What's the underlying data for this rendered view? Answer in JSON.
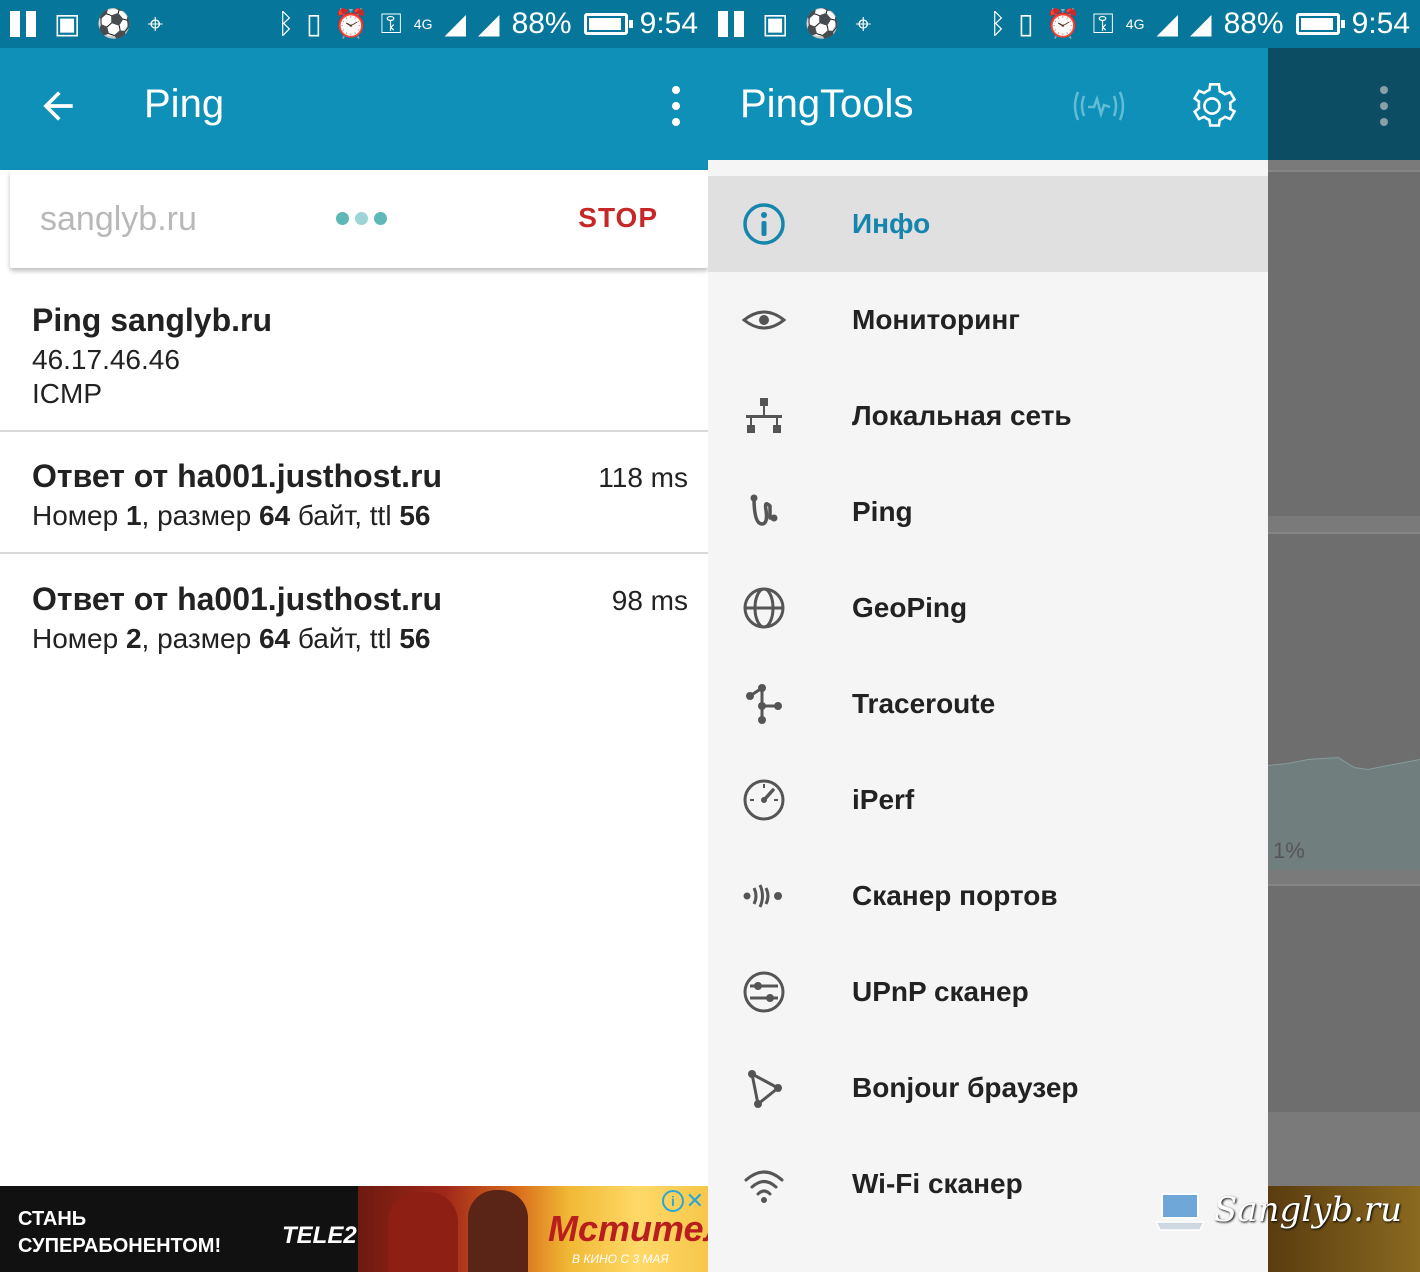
{
  "status_bar": {
    "battery": "88%",
    "time": "9:54",
    "network": "4G"
  },
  "left": {
    "appbar": {
      "title": "Ping"
    },
    "search": {
      "value": "sanglyb.ru",
      "stop_label": "STOP"
    },
    "header_result": {
      "title": "Ping sanglyb.ru",
      "ip": "46.17.46.46",
      "protocol": "ICMP"
    },
    "replies": [
      {
        "title": "Ответ от ha001.justhost.ru",
        "ms": "118 ms",
        "num_label": "Номер",
        "num": "1",
        "size_label": ", размер",
        "size": "64",
        "ttl_label": "байт, ttl",
        "ttl": "56"
      },
      {
        "title": "Ответ от ha001.justhost.ru",
        "ms": "98 ms",
        "num_label": "Номер",
        "num": "2",
        "size_label": ", размер",
        "size": "64",
        "ttl_label": "байт, ttl",
        "ttl": "56"
      }
    ],
    "ad": {
      "text_line1": "СТАНЬ",
      "text_line2": "СУПЕРАБОНЕНТОМ!",
      "brand": "TELE2",
      "movie_title": "Мстители",
      "movie_sub": "В КИНО С 3 МАЯ"
    }
  },
  "right": {
    "drawer": {
      "title": "PingTools",
      "items": [
        {
          "label": "Инфо",
          "icon": "info-icon"
        },
        {
          "label": "Мониторинг",
          "icon": "eye-icon"
        },
        {
          "label": "Локальная сеть",
          "icon": "lan-icon"
        },
        {
          "label": "Ping",
          "icon": "ping-icon"
        },
        {
          "label": "GeoPing",
          "icon": "globe-icon"
        },
        {
          "label": "Traceroute",
          "icon": "traceroute-icon"
        },
        {
          "label": "iPerf",
          "icon": "speedometer-icon"
        },
        {
          "label": "Сканер портов",
          "icon": "port-scanner-icon"
        },
        {
          "label": "UPnP сканер",
          "icon": "upnp-icon"
        },
        {
          "label": "Bonjour браузер",
          "icon": "bonjour-icon"
        },
        {
          "label": "Wi-Fi сканер",
          "icon": "wifi-icon"
        }
      ]
    },
    "background_percent": "1%",
    "watermark": "Sanglyb.ru"
  },
  "colors": {
    "appbar": "#0f90b8",
    "statusbar": "#06779a",
    "accent_active": "#1585ad",
    "stop": "#c62828"
  }
}
